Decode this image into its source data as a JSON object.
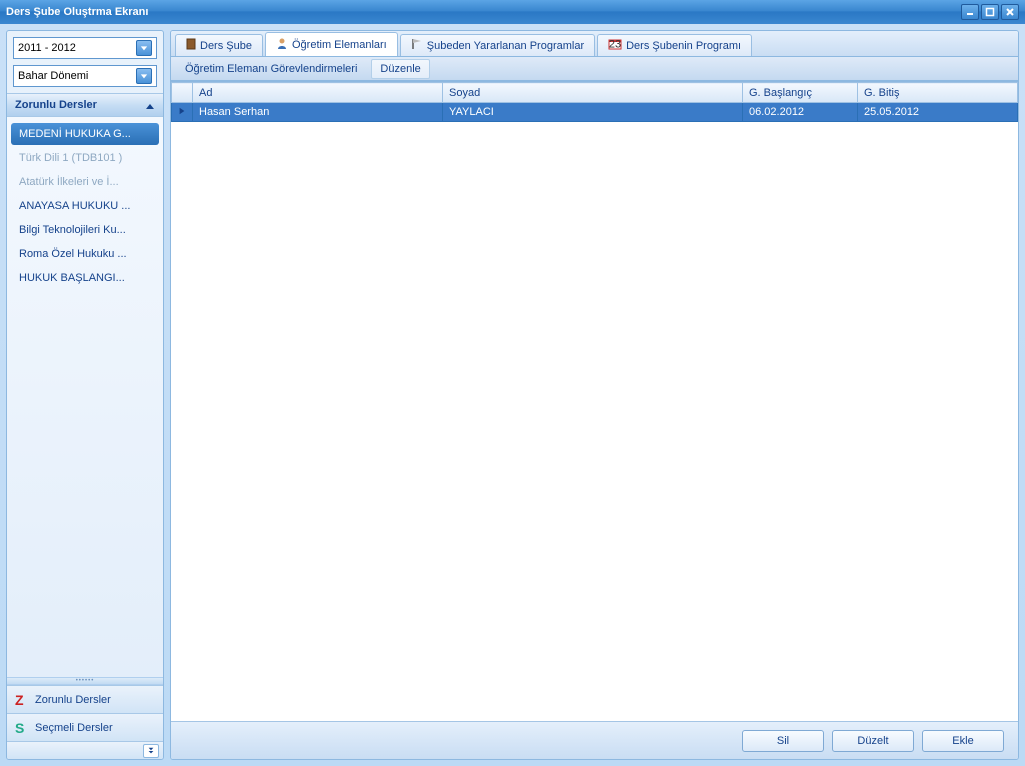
{
  "window": {
    "title": "Ders Şube Oluştrma Ekranı"
  },
  "filters": {
    "year": "2011 - 2012",
    "term": "Bahar Dönemi"
  },
  "sidebar": {
    "mandatory_header": "Zorunlu Dersler",
    "courses": [
      {
        "label": "MEDENİ HUKUKA G...",
        "selected": true,
        "disabled": false
      },
      {
        "label": "Türk Dili 1 (TDB101  )",
        "selected": false,
        "disabled": true
      },
      {
        "label": "Atatürk İlkeleri ve İ...",
        "selected": false,
        "disabled": true
      },
      {
        "label": "ANAYASA HUKUKU ...",
        "selected": false,
        "disabled": false
      },
      {
        "label": "Bilgi Teknolojileri Ku...",
        "selected": false,
        "disabled": false
      },
      {
        "label": "Roma Özel Hukuku ...",
        "selected": false,
        "disabled": false
      },
      {
        "label": "HUKUK  BAŞLANGI...",
        "selected": false,
        "disabled": false
      }
    ],
    "nav": {
      "mandatory": "Zorunlu Dersler",
      "elective": "Seçmeli Dersler"
    }
  },
  "tabs": {
    "items": [
      {
        "label": "Ders Şube"
      },
      {
        "label": "Öğretim Elemanları"
      },
      {
        "label": "Şubeden Yararlanan  Programlar"
      },
      {
        "label": "Ders Şubenin Programı"
      }
    ],
    "active_index": 1
  },
  "subtabs": {
    "assignments": "Öğretim Elemanı Görevlendirmeleri",
    "edit": "Düzenle"
  },
  "grid": {
    "headers": {
      "ad": "Ad",
      "soyad": "Soyad",
      "start": "G. Başlangıç",
      "end": "G. Bitiş"
    },
    "rows": [
      {
        "ad": "Hasan Serhan",
        "soyad": "YAYLACI",
        "start": "06.02.2012",
        "end": "25.05.2012"
      }
    ]
  },
  "buttons": {
    "delete": "Sil",
    "edit": "Düzelt",
    "add": "Ekle"
  }
}
